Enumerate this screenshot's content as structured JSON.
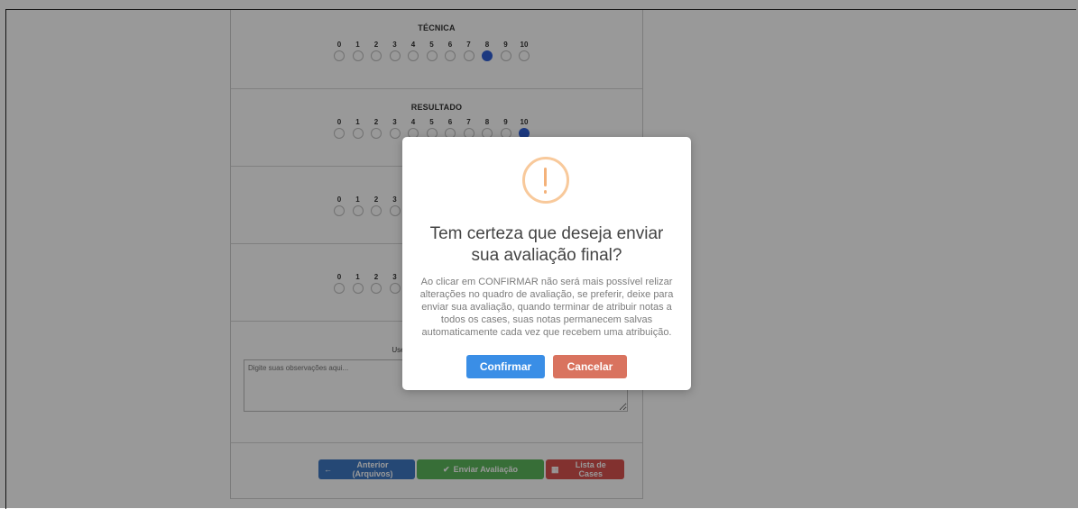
{
  "colors": {
    "selected_radio": "#2f5fd6",
    "btn_prev": "#3f78c4",
    "btn_send": "#5cb85c",
    "btn_list": "#d9534f",
    "confirm": "#3a8ee6",
    "cancel": "#d9735f",
    "warning": "#f8bb86"
  },
  "scale_numbers": [
    "0",
    "1",
    "2",
    "3",
    "4",
    "5",
    "6",
    "7",
    "8",
    "9",
    "10"
  ],
  "sections": [
    {
      "title": "TÉCNICA",
      "selected": 8
    },
    {
      "title": "RESULTADO",
      "selected": 10
    },
    {
      "title": "",
      "selected": null
    },
    {
      "title": "",
      "selected": null
    }
  ],
  "observations": {
    "label": "Use este campo para adicio",
    "placeholder": "Digite suas observações aqui..."
  },
  "buttons": {
    "previous": "Anterior (Arquivos)",
    "send": "Enviar Avaliação",
    "list": "Lista de Cases"
  },
  "icons": {
    "previous": "arrow-left-icon",
    "send": "check-icon",
    "list": "list-icon",
    "warning": "exclamation-icon"
  },
  "modal": {
    "title_line1": "Tem certeza que deseja enviar",
    "title_line2": "sua avaliação final?",
    "text_lines": [
      "Ao clicar em CONFIRMAR não será mais possível relizar",
      "alterações no quadro de avaliação, se preferir, deixe para",
      "enviar sua avaliação, quando terminar de atribuir notas a",
      "todos os cases, suas notas permanecem salvas",
      "automaticamente cada vez que recebem uma atribuição."
    ],
    "confirm": "Confirmar",
    "cancel": "Cancelar"
  }
}
